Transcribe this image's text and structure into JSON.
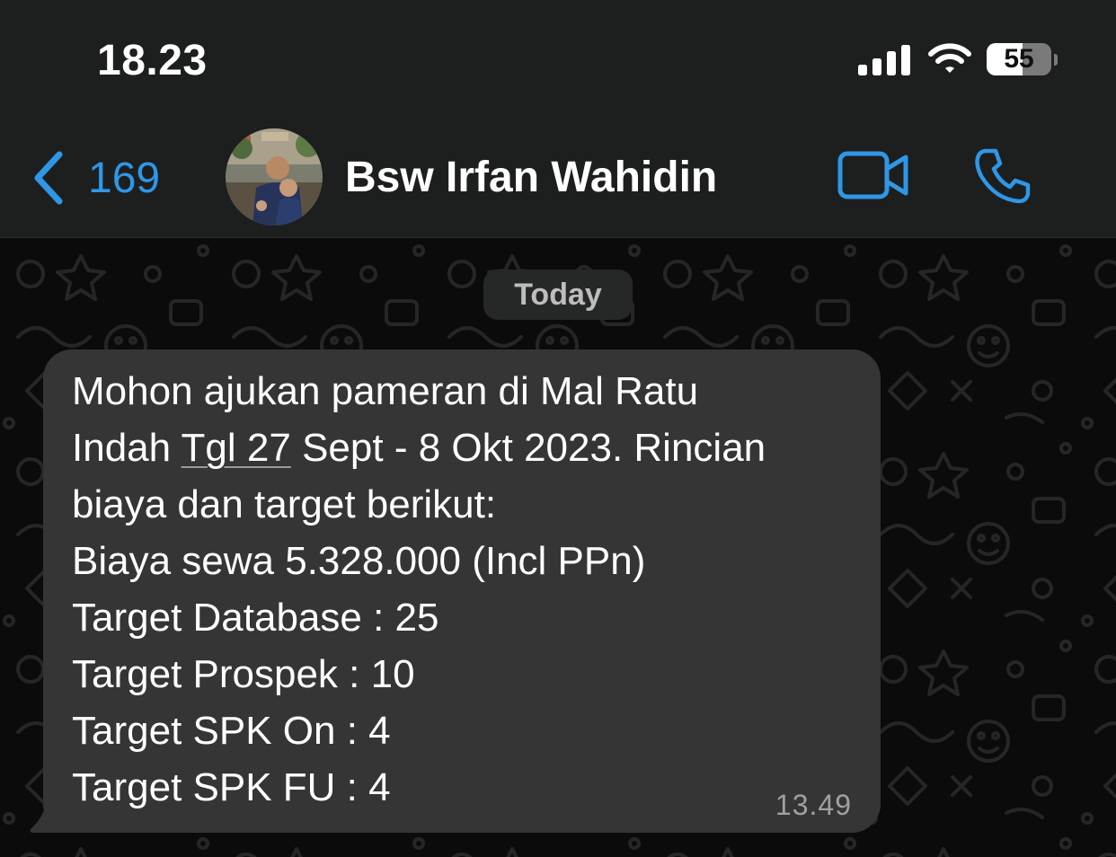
{
  "status_bar": {
    "time": "18.23",
    "battery_level": "55",
    "battery_fraction": 0.55,
    "signal_icon": "cellular-signal-icon",
    "wifi_icon": "wifi-icon"
  },
  "header": {
    "back_count": "169",
    "back_icon": "chevron-left-icon",
    "contact_name": "Bsw Irfan Wahidin",
    "video_icon": "video-camera-icon",
    "call_icon": "phone-icon",
    "accent_color": "#2f97e6"
  },
  "chat": {
    "date_label": "Today",
    "message": {
      "lines": [
        "Mohon ajukan pameran di Mal Ratu",
        "Sept - 8 Okt 2023. Rincian",
        "biaya dan target berikut:",
        "Biaya sewa 5.328.000 (Incl PPn)",
        "Target Database : 25",
        "Target Prospek : 10",
        "Target SPK On : 4",
        "Target SPK FU : 4"
      ],
      "line2_prefix": "Indah",
      "date_link": "Tgl 27",
      "time": "13.49",
      "bubble_color": "#353535"
    }
  }
}
